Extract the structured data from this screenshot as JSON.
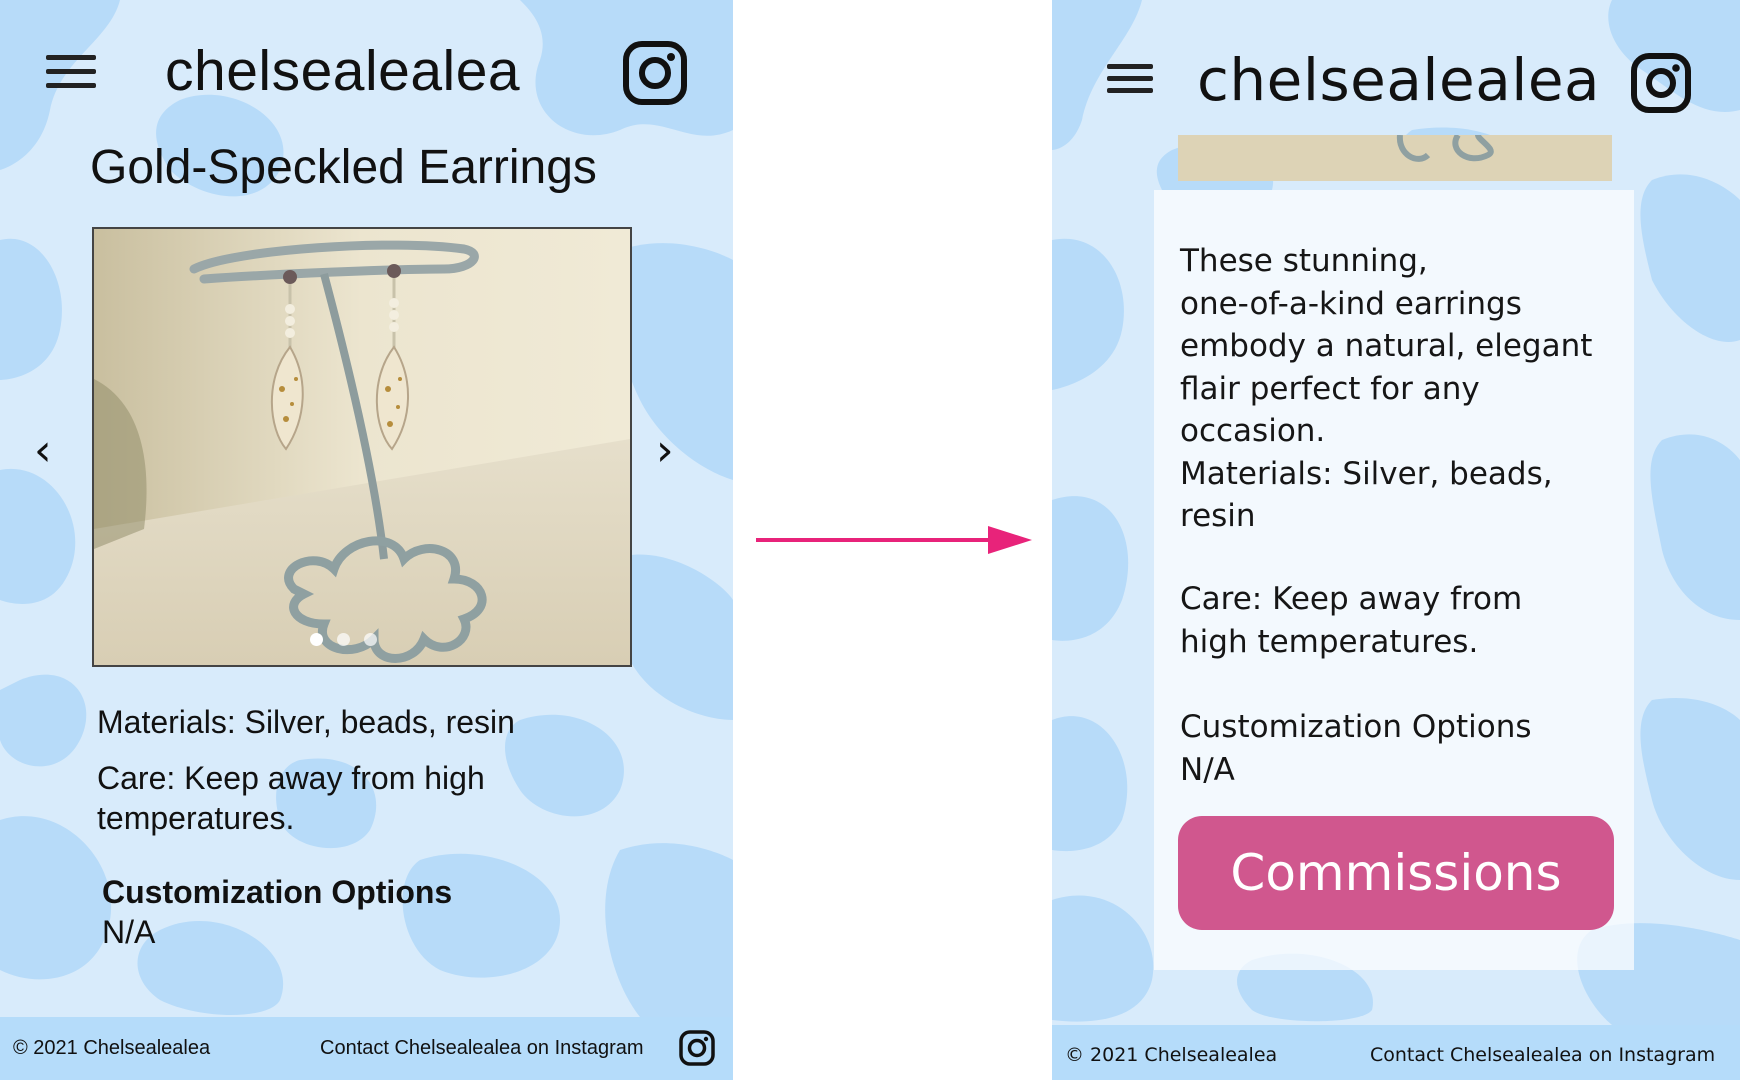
{
  "left_screen": {
    "brand": "chelsealealea",
    "menu_icon": "hamburger-menu-icon",
    "social_icon": "instagram-icon",
    "product_title": "Gold-Speckled Earrings",
    "carousel": {
      "prev_glyph": "‹",
      "next_glyph": "›",
      "slide_count": 3,
      "active_slide": 1
    },
    "materials": "Materials: Silver, beads, resin",
    "care": "Care: Keep away from high temperatures.",
    "customization_heading": "Customization Options",
    "customization_value": "N/A",
    "footer": {
      "copyright": "© 2021 Chelsealealea",
      "contact": "Contact Chelsealealea on Instagram"
    }
  },
  "right_screen": {
    "brand": "chelsealealea",
    "menu_icon": "hamburger-menu-icon",
    "social_icon": "instagram-icon",
    "description_lines": [
      "These stunning,",
      "one-of-a-kind earrings",
      "embody a natural, elegant",
      "flair perfect for any",
      "occasion.",
      "Materials: Silver, beads,",
      "resin"
    ],
    "care_lines": [
      "Care: Keep away from",
      "high temperatures."
    ],
    "customization_heading": "Customization Options",
    "customization_value": "N/A",
    "commissions_button": "Commissions",
    "footer": {
      "copyright": "© 2021 Chelsealealea",
      "contact": "Contact Chelsealealea on Instagram"
    }
  },
  "colors": {
    "background_light_blue": "#d8ebfb",
    "footer_blue": "#b5dcfa",
    "blob_blue": "#b7dbf9",
    "button_pink": "#d0578e",
    "arrow_pink": "#e8237a"
  }
}
